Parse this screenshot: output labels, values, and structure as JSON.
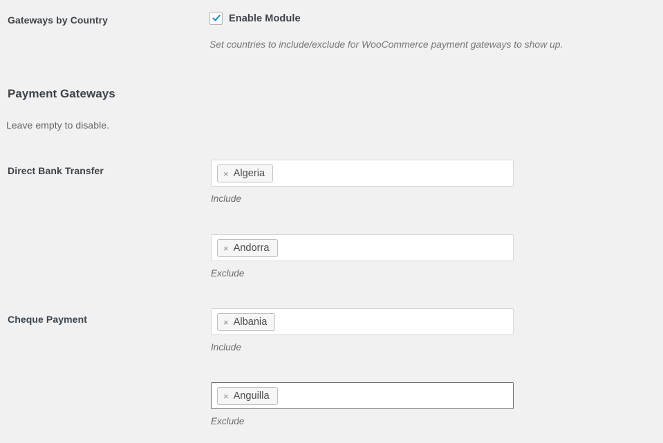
{
  "module": {
    "label": "Gateways by Country",
    "checkbox_label": "Enable Module",
    "checked": true,
    "description": "Set countries to include/exclude for WooCommerce payment gateways to show up."
  },
  "section": {
    "title": "Payment Gateways",
    "subtitle": "Leave empty to disable."
  },
  "gateways": [
    {
      "label": "Direct Bank Transfer",
      "include": {
        "hint": "Include",
        "tags": [
          {
            "name": "Algeria",
            "remove": "×"
          }
        ],
        "focused": false
      },
      "exclude": {
        "hint": "Exclude",
        "tags": [
          {
            "name": "Andorra",
            "remove": "×"
          }
        ],
        "focused": false
      }
    },
    {
      "label": "Cheque Payment",
      "include": {
        "hint": "Include",
        "tags": [
          {
            "name": "Albania",
            "remove": "×"
          }
        ],
        "focused": false
      },
      "exclude": {
        "hint": "Exclude",
        "tags": [
          {
            "name": "Anguilla",
            "remove": "×"
          }
        ],
        "focused": true
      }
    }
  ],
  "colors": {
    "background": "#f1f1f1",
    "heading_text": "#3c434a",
    "muted_text": "#787878",
    "field_border": "#d6d6d6",
    "field_border_focus": "#6e6e6e",
    "checkbox_check": "#1e8cbe",
    "tag_background": "#f6f6f6",
    "tag_border": "#bfbfbf"
  }
}
